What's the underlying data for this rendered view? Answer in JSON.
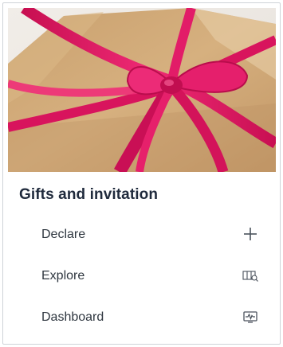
{
  "card": {
    "title": "Gifts and invitation"
  },
  "menu": {
    "items": [
      {
        "label": "Declare",
        "icon": "plus-icon"
      },
      {
        "label": "Explore",
        "icon": "map-search-icon"
      },
      {
        "label": "Dashboard",
        "icon": "monitor-chart-icon"
      }
    ]
  },
  "colors": {
    "title": "#1f2a3c",
    "label": "#2f3740",
    "ribbon": "#e0155f",
    "kraft_paper": "#cfa674",
    "border": "#cfd3d8"
  }
}
